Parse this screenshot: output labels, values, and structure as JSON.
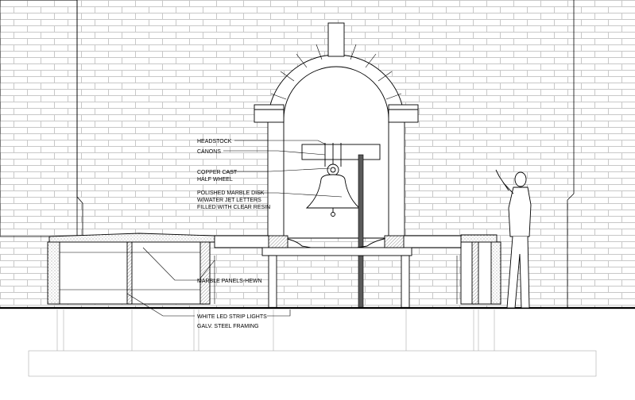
{
  "labels": {
    "headstock": "HEADSTOCK",
    "canons": "CANONS",
    "copper_cast_1": "COPPER CAST",
    "copper_cast_2": "HALF WHEEL",
    "marble_disk_1": "POLISHED MARBLE DISK",
    "marble_disk_2": "W/WATER JET LETTERS",
    "marble_disk_3": "FILLED WITH CLEAR RESIN",
    "marble_panels": "MARBLE PANELS-HEWN",
    "led_strip": "WHITE LED STRIP LIGHTS",
    "steel_framing": "GALV. STEEL FRAMING"
  },
  "colors": {
    "line": "#000000",
    "brick": "#c8c8c8",
    "hatch": "#909090",
    "pole": "#5a5a5a"
  }
}
